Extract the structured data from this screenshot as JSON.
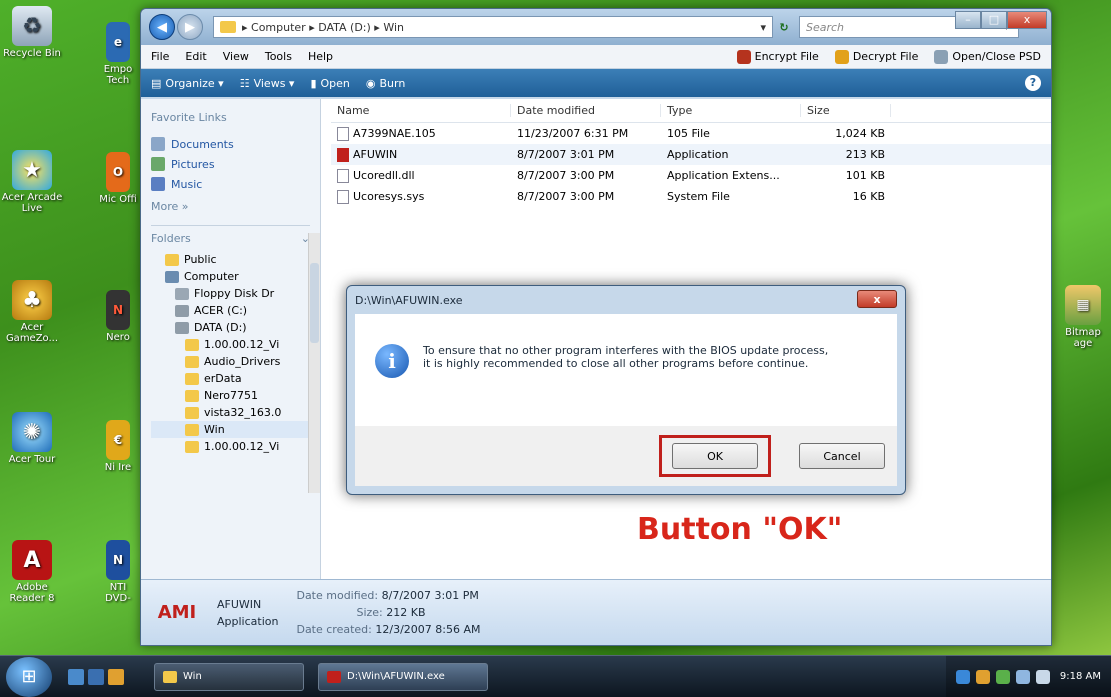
{
  "desktop": {
    "icons": [
      {
        "label": "Recycle Bin"
      },
      {
        "label": "Acer Arcade Live"
      },
      {
        "label": "Acer GameZo..."
      },
      {
        "label": "Acer Tour"
      },
      {
        "label": "Adobe Reader 8"
      },
      {
        "label": "Empo Tech"
      },
      {
        "label": "Mic Offi"
      },
      {
        "label": "Nero"
      },
      {
        "label": "Ni Ire"
      },
      {
        "label": "NTI DVD-"
      },
      {
        "label": "Bitmap age"
      }
    ]
  },
  "explorer": {
    "address": "▸ Computer ▸ DATA (D:) ▸ Win",
    "search_placeholder": "Search",
    "menu": [
      "File",
      "Edit",
      "View",
      "Tools",
      "Help"
    ],
    "menu_actions": [
      "Encrypt File",
      "Decrypt File",
      "Open/Close PSD"
    ],
    "toolbar": [
      "Organize ▾",
      "Views ▾",
      "Open",
      "Burn"
    ],
    "favorites_header": "Favorite Links",
    "favorites": [
      "Documents",
      "Pictures",
      "Music"
    ],
    "more": "More »",
    "folders_header": "Folders",
    "tree": [
      "Public",
      "Computer",
      "Floppy Disk Dr",
      "ACER (C:)",
      "DATA (D:)",
      "1.00.00.12_Vi",
      "Audio_Drivers",
      "erData",
      "Nero7751",
      "vista32_163.0",
      "Win",
      "1.00.00.12_Vi"
    ],
    "columns": [
      "Name",
      "Date modified",
      "Type",
      "Size"
    ],
    "files": [
      {
        "name": "A7399NAE.105",
        "date": "11/23/2007 6:31 PM",
        "type": "105 File",
        "size": "1,024 KB"
      },
      {
        "name": "AFUWIN",
        "date": "8/7/2007 3:01 PM",
        "type": "Application",
        "size": "213 KB"
      },
      {
        "name": "Ucoredll.dll",
        "date": "8/7/2007 3:00 PM",
        "type": "Application Extens...",
        "size": "101 KB"
      },
      {
        "name": "Ucoresys.sys",
        "date": "8/7/2007 3:00 PM",
        "type": "System File",
        "size": "16 KB"
      }
    ],
    "details": {
      "name": "AFUWIN",
      "kind": "Application",
      "date_modified_label": "Date modified:",
      "date_modified": "8/7/2007 3:01 PM",
      "size_label": "Size:",
      "size": "212 KB",
      "date_created_label": "Date created:",
      "date_created": "12/3/2007 8:56 AM",
      "icon_text": "AMI"
    }
  },
  "dialog": {
    "title": "D:\\Win\\AFUWIN.exe",
    "message_line1": "To ensure that no other program interferes with the BIOS update process,",
    "message_line2": "it is highly recommended to close all other programs before continue.",
    "ok_label": "OK",
    "cancel_label": "Cancel",
    "close_glyph": "x"
  },
  "callout": "Button \"OK\"",
  "taskbar": {
    "tasks": [
      "Win",
      "D:\\Win\\AFUWIN.exe"
    ],
    "clock": "9:18 AM"
  },
  "colors": {
    "accent_red": "#d8261a",
    "vista_blue": "#1f5f98"
  }
}
